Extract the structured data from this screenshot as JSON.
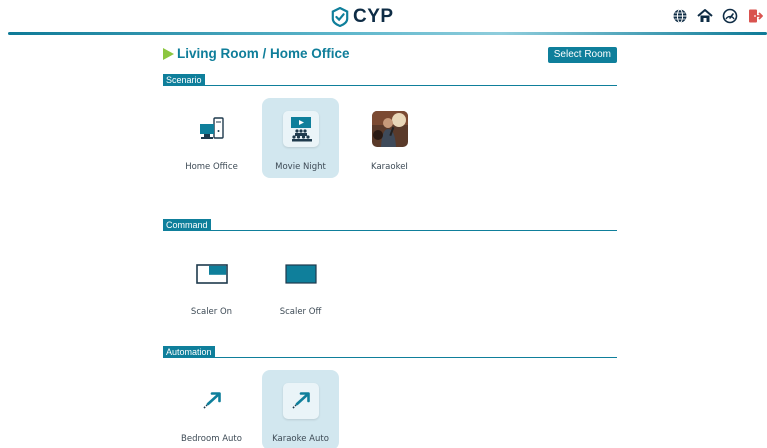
{
  "header": {
    "brand": "CYP",
    "icons": [
      "globe-icon",
      "home-icon",
      "gauge-icon",
      "logout-icon"
    ]
  },
  "page": {
    "room_title": "Living Room / Home Office",
    "select_room_label": "Select Room"
  },
  "sections": {
    "scenario": {
      "label": "Scenario",
      "items": [
        {
          "label": "Home Office",
          "icon": "desktop-computer-icon",
          "active": false
        },
        {
          "label": "Movie Night",
          "icon": "cinema-audience-icon",
          "active": true
        },
        {
          "label": "KaraokeI",
          "icon": "karaoke-photo",
          "active": false
        }
      ]
    },
    "command": {
      "label": "Command",
      "items": [
        {
          "label": "Scaler On",
          "icon": "scaler-on-icon",
          "active": false
        },
        {
          "label": "Scaler Off",
          "icon": "scaler-off-icon",
          "active": false
        }
      ]
    },
    "automation": {
      "label": "Automation",
      "items": [
        {
          "label": "Bedroom Auto",
          "icon": "automation-arrow-icon",
          "active": false
        },
        {
          "label": "Karaoke Auto",
          "icon": "automation-arrow-icon",
          "active": true
        }
      ]
    }
  },
  "colors": {
    "accent": "#0f7f9b",
    "arrow": "#8cc63f",
    "active_tile": "#d2e7ef",
    "brand_dark": "#0e2c45",
    "logout_red": "#d9534f"
  }
}
